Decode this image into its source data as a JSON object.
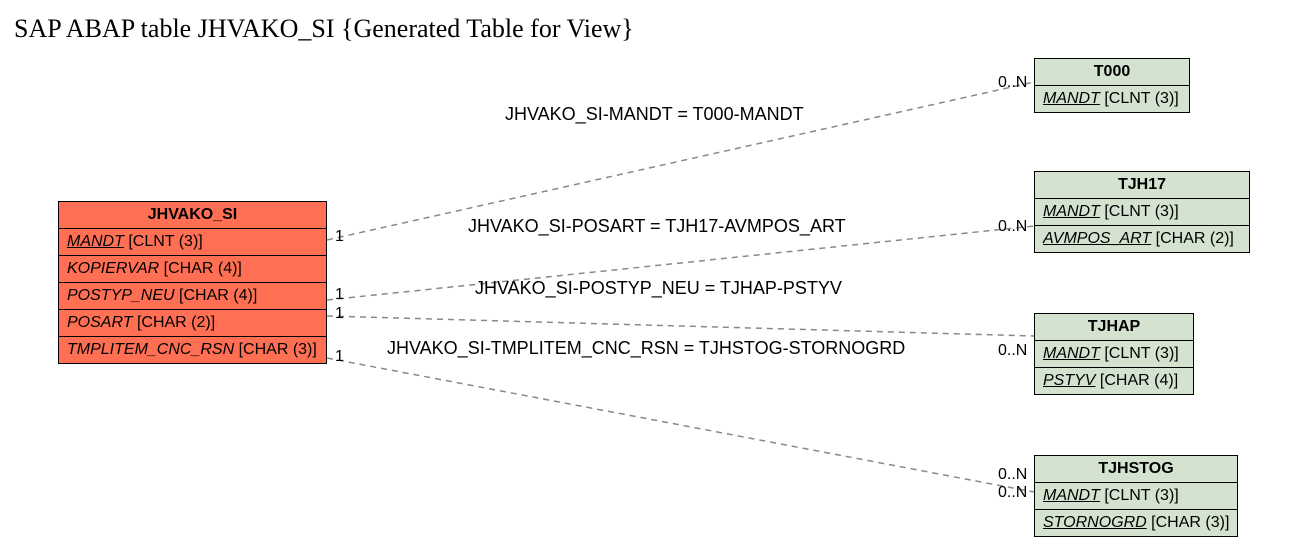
{
  "title": "SAP ABAP table JHVAKO_SI {Generated Table for View}",
  "main": {
    "name": "JHVAKO_SI",
    "rows": [
      {
        "field": "MANDT",
        "type": "[CLNT (3)]",
        "key": true
      },
      {
        "field": "KOPIERVAR",
        "type": "[CHAR (4)]",
        "key": false
      },
      {
        "field": "POSTYP_NEU",
        "type": "[CHAR (4)]",
        "key": false
      },
      {
        "field": "POSART",
        "type": "[CHAR (2)]",
        "key": false
      },
      {
        "field": "TMPLITEM_CNC_RSN",
        "type": "[CHAR (3)]",
        "key": false
      }
    ]
  },
  "targets": [
    {
      "name": "T000",
      "rows": [
        {
          "field": "MANDT",
          "type": "[CLNT (3)]",
          "key": true
        }
      ]
    },
    {
      "name": "TJH17",
      "rows": [
        {
          "field": "MANDT",
          "type": "[CLNT (3)]",
          "key": true
        },
        {
          "field": "AVMPOS_ART",
          "type": "[CHAR (2)]",
          "key": true
        }
      ]
    },
    {
      "name": "TJHAP",
      "rows": [
        {
          "field": "MANDT",
          "type": "[CLNT (3)]",
          "key": true
        },
        {
          "field": "PSTYV",
          "type": "[CHAR (4)]",
          "key": true
        }
      ]
    },
    {
      "name": "TJHSTOG",
      "rows": [
        {
          "field": "MANDT",
          "type": "[CLNT (3)]",
          "key": true
        },
        {
          "field": "STORNOGRD",
          "type": "[CHAR (3)]",
          "key": true
        }
      ]
    }
  ],
  "relations": [
    {
      "label": "JHVAKO_SI-MANDT = T000-MANDT",
      "leftCard": "1",
      "rightCard": "0..N"
    },
    {
      "label": "JHVAKO_SI-POSART = TJH17-AVMPOS_ART",
      "leftCard": "1",
      "rightCard": "0..N"
    },
    {
      "label": "JHVAKO_SI-POSTYP_NEU = TJHAP-PSTYV",
      "leftCard": "1",
      "rightCard": ""
    },
    {
      "label": "JHVAKO_SI-TMPLITEM_CNC_RSN = TJHSTOG-STORNOGRD",
      "leftCard": "1",
      "rightCard": "0..N"
    }
  ],
  "extraCards": {
    "tjhapBottom": "0..N",
    "tjhstogTop": "0..N"
  }
}
